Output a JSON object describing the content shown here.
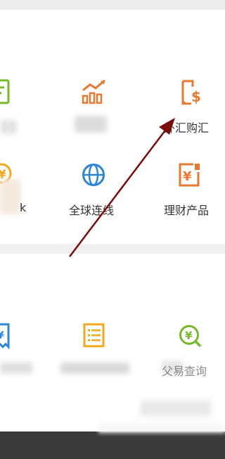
{
  "grid": {
    "row1": {
      "forex_purchase_label": "外汇购汇"
    },
    "row2": {
      "global_connect_label": "全球连线",
      "wealth_products_label": "理财产品",
      "left_partial_label": "k"
    },
    "row3": {
      "right_partial_label": "父易查询"
    }
  },
  "icons": {
    "col1_row1": "document-icon",
    "col2_row1": "bar-chart-growth-icon",
    "col3_row1": "phone-dollar-icon",
    "col1_row2": "coin-icon",
    "col2_row2": "globe-icon",
    "col3_row2": "wealth-yen-icon",
    "col1_row3": "receipt-icon",
    "col2_row3": "list-doc-icon",
    "col3_row3": "yen-search-icon"
  },
  "colors": {
    "orange": "#e9792e",
    "blue": "#2e84d8",
    "green": "#76b82a",
    "gold": "#f0a91b",
    "arrow": "#7a0b0b"
  }
}
